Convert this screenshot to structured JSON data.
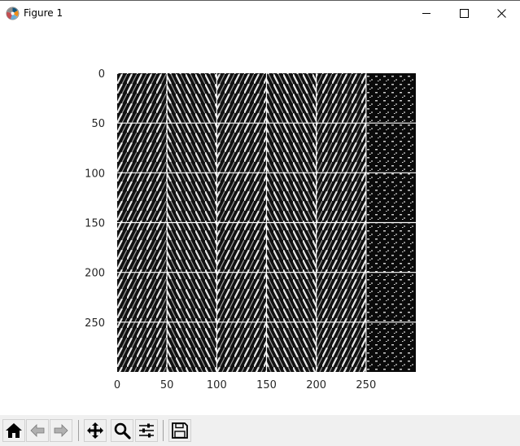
{
  "window": {
    "title": "Figure 1",
    "icon": "matplotlib-logo-icon",
    "controls": [
      "minimize-icon",
      "maximize-icon",
      "close-icon"
    ]
  },
  "figure": {
    "image_description_colormap": "gray",
    "grid_color": "#ffffff",
    "x_ticks": [
      "0",
      "50",
      "100",
      "150",
      "200",
      "250"
    ],
    "y_ticks": [
      "0",
      "50",
      "100",
      "150",
      "200",
      "250"
    ],
    "x_tick_values": [
      0,
      50,
      100,
      150,
      200,
      250
    ],
    "y_tick_values": [
      0,
      50,
      100,
      150,
      200,
      250
    ],
    "data_extent": [
      0,
      300
    ],
    "tile_grid": {
      "rows": 6,
      "cols": 6
    }
  },
  "toolbar": {
    "buttons": [
      {
        "name": "home-button",
        "icon": "home-icon"
      },
      {
        "name": "back-button",
        "icon": "arrow-left-icon"
      },
      {
        "name": "forward-button",
        "icon": "arrow-right-icon"
      },
      {
        "name": "pan-button",
        "icon": "move-icon"
      },
      {
        "name": "zoom-button",
        "icon": "magnifier-icon"
      },
      {
        "name": "configure-subplots-button",
        "icon": "sliders-icon"
      },
      {
        "name": "save-button",
        "icon": "floppy-disk-icon"
      }
    ]
  }
}
